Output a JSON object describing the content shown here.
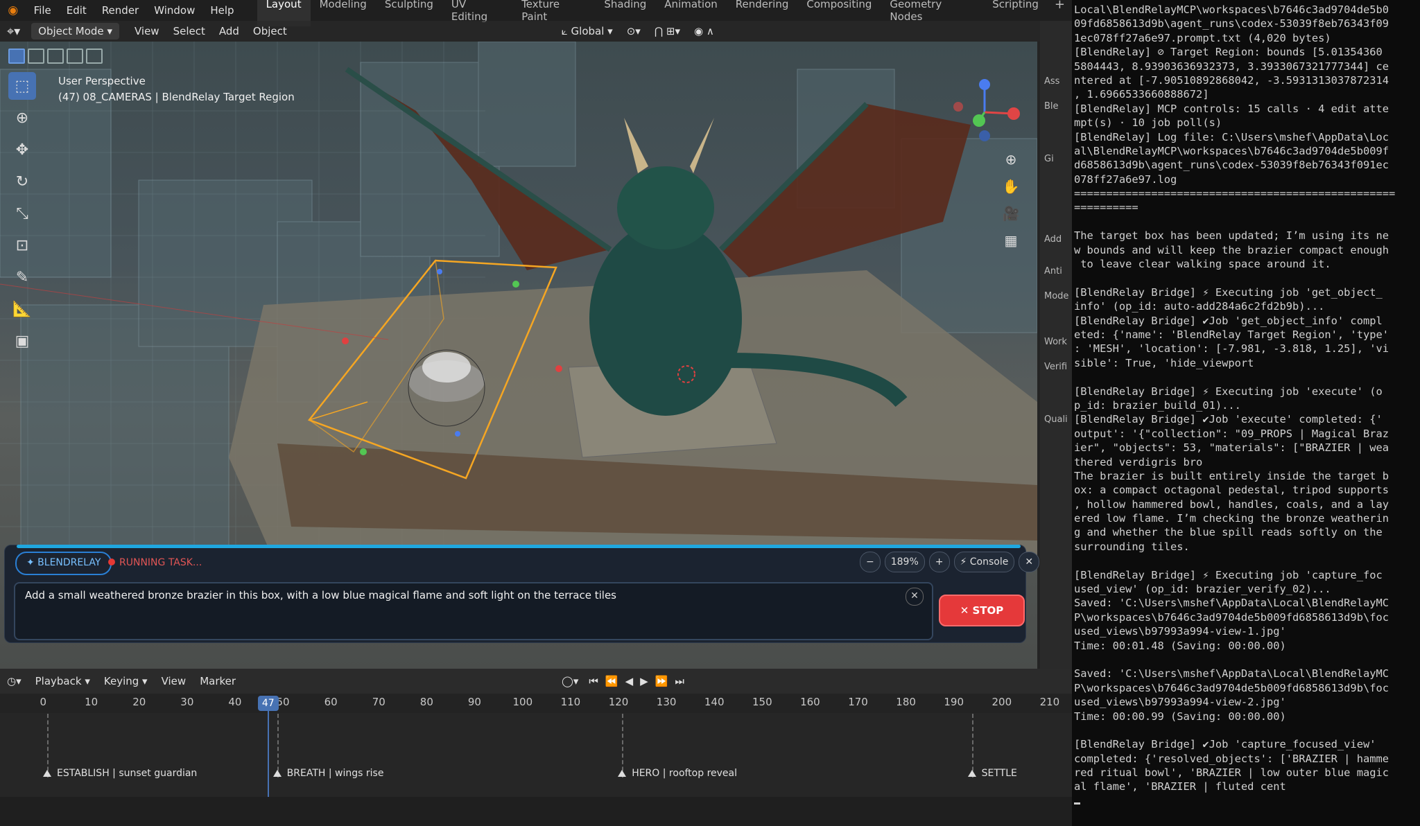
{
  "menubar": {
    "items": [
      "File",
      "Edit",
      "Render",
      "Window",
      "Help"
    ],
    "workspaces": [
      "Layout",
      "Modeling",
      "Sculpting",
      "UV Editing",
      "Texture Paint",
      "Shading",
      "Animation",
      "Rendering",
      "Compositing",
      "Geometry Nodes",
      "Scripting"
    ],
    "active_workspace": "Layout"
  },
  "header": {
    "mode": "Object Mode",
    "menus": [
      "View",
      "Select",
      "Add",
      "Object"
    ],
    "transform_orientation": "Global"
  },
  "viewport": {
    "perspective": "User Perspective",
    "context": "(47) 08_CAMERAS | BlendRelay Target Region"
  },
  "right_strip": [
    "Ass",
    "Ble",
    "Gi",
    "Add",
    "Anti",
    "Mode",
    "Work",
    "Verifi",
    "Quali"
  ],
  "blendrelay": {
    "badge": "✦ BLENDRELAY",
    "status": "RUNNING TASK...",
    "zoom_minus": "−",
    "zoom": "189%",
    "zoom_plus": "+",
    "console_button": "⚡ Console",
    "close": "✕",
    "prompt": "Add a small weathered bronze brazier in this box, with a low blue magical flame and soft light on the terrace tiles",
    "clear": "✕",
    "stop_label": "✕ STOP"
  },
  "timeline": {
    "menus": [
      "Playback",
      "Keying",
      "View",
      "Marker"
    ],
    "ticks": [
      "0",
      "10",
      "20",
      "30",
      "40",
      "50",
      "60",
      "70",
      "80",
      "90",
      "100",
      "110",
      "120",
      "130",
      "140",
      "150",
      "160",
      "170",
      "180",
      "190",
      "200",
      "210"
    ],
    "current_frame": "47",
    "markers": [
      {
        "frame": 0,
        "label": "ESTABLISH | sunset guardian"
      },
      {
        "frame": 48,
        "label": "BREATH | wings rise"
      },
      {
        "frame": 120,
        "label": "HERO | rooftop reveal"
      },
      {
        "frame": 193,
        "label": "SETTLE"
      }
    ]
  },
  "console": {
    "lines": [
      "Local\\BlendRelayMCP\\workspaces\\b7646c3ad9704de5b0",
      "09fd6858613d9b\\agent_runs\\codex-53039f8eb76343f09",
      "1ec078ff27a6e97.prompt.txt (4,020 bytes)",
      "[BlendRelay] ⊘ Target Region: bounds [5.01354360",
      "5804443, 8.93903636932373, 3.3933067321777344] ce",
      "ntered at [-7.90510892868042, -3.5931313037872314",
      ", 1.6966533660888672]",
      "[BlendRelay] MCP controls: 15 calls · 4 edit atte",
      "mpt(s) · 10 job poll(s)",
      "[BlendRelay] Log file: C:\\Users\\mshef\\AppData\\Loc",
      "al\\BlendRelayMCP\\workspaces\\b7646c3ad9704de5b009f",
      "d6858613d9b\\agent_runs\\codex-53039f8eb76343f091ec",
      "078ff27a6e97.log",
      "==================================================",
      "==========",
      "",
      "The target box has been updated; I’m using its ne",
      "w bounds and will keep the brazier compact enough",
      " to leave clear walking space around it.",
      "",
      "[BlendRelay Bridge] ⚡ Executing job 'get_object_",
      "info' (op_id: auto-add284a6c2fd2b9b)...",
      "[BlendRelay Bridge] ✔Job 'get_object_info' compl",
      "eted: {'name': 'BlendRelay Target Region', 'type'",
      ": 'MESH', 'location': [-7.981, -3.818, 1.25], 'vi",
      "sible': True, 'hide_viewport",
      "",
      "[BlendRelay Bridge] ⚡ Executing job 'execute' (o",
      "p_id: brazier_build_01)...",
      "[BlendRelay Bridge] ✔Job 'execute' completed: {'",
      "output': '{\"collection\": \"09_PROPS | Magical Braz",
      "ier\", \"objects\": 53, \"materials\": [\"BRAZIER | wea",
      "thered verdigris bro",
      "The brazier is built entirely inside the target b",
      "ox: a compact octagonal pedestal, tripod supports",
      ", hollow hammered bowl, handles, coals, and a lay",
      "ered low flame. I’m checking the bronze weatherin",
      "g and whether the blue spill reads softly on the",
      "surrounding tiles.",
      "",
      "[BlendRelay Bridge] ⚡ Executing job 'capture_foc",
      "used_view' (op_id: brazier_verify_02)...",
      "Saved: 'C:\\Users\\mshef\\AppData\\Local\\BlendRelayMC",
      "P\\workspaces\\b7646c3ad9704de5b009fd6858613d9b\\foc",
      "used_views\\b97993a994-view-1.jpg'",
      "Time: 00:01.48 (Saving: 00:00.00)",
      "",
      "Saved: 'C:\\Users\\mshef\\AppData\\Local\\BlendRelayMC",
      "P\\workspaces\\b7646c3ad9704de5b009fd6858613d9b\\foc",
      "used_views\\b97993a994-view-2.jpg'",
      "Time: 00:00.99 (Saving: 00:00.00)",
      "",
      "[BlendRelay Bridge] ✔Job 'capture_focused_view'",
      "completed: {'resolved_objects': ['BRAZIER | hamme",
      "red ritual bowl', 'BRAZIER | low outer blue magic",
      "al flame', 'BRAZIER | fluted cent"
    ]
  }
}
